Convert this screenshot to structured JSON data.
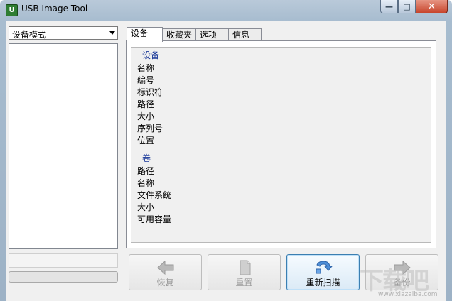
{
  "window": {
    "title": "USB Image Tool",
    "app_icon_glyph": "U",
    "controls": {
      "minimize": "—",
      "maximize": "□",
      "close": "✕"
    }
  },
  "left_pane": {
    "mode_select": {
      "value": "设备模式"
    }
  },
  "tabs": [
    {
      "label": "设备",
      "active": true
    },
    {
      "label": "收藏夹",
      "active": false
    },
    {
      "label": "选项",
      "active": false
    },
    {
      "label": "信息",
      "active": false
    }
  ],
  "device_section": {
    "header": "设备",
    "fields": [
      "名称",
      "编号",
      "标识符",
      "路径",
      "大小",
      "序列号",
      "位置"
    ]
  },
  "volume_section": {
    "header": "卷",
    "fields": [
      "路径",
      "名称",
      "文件系统",
      "大小",
      "可用容量"
    ]
  },
  "buttons": [
    {
      "label": "恢复",
      "icon": "restore-arrow-icon",
      "enabled": false
    },
    {
      "label": "重置",
      "icon": "reset-document-icon",
      "enabled": false
    },
    {
      "label": "重新扫描",
      "icon": "rescan-arrow-icon",
      "enabled": true
    },
    {
      "label": "备份",
      "icon": "backup-arrow-icon",
      "enabled": false
    }
  ],
  "progress": {
    "fraction": 0
  },
  "watermark": {
    "text": "下载吧",
    "url": "www.xiazaiba.com"
  },
  "colors": {
    "section_header": "#1d3b9a",
    "primary_border": "#3c7fb1",
    "close_button": "#c7452c"
  }
}
